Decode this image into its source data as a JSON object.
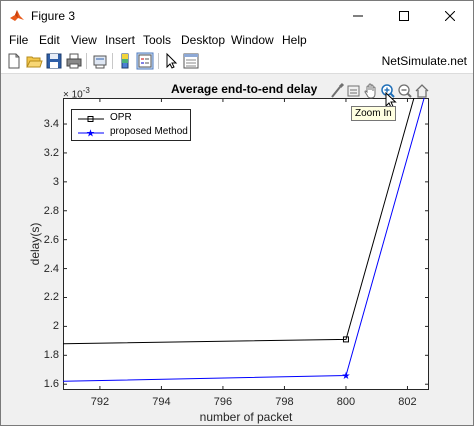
{
  "window": {
    "title": "Figure 3",
    "controls": {
      "minimize": "minimize",
      "maximize": "maximize",
      "close": "close"
    }
  },
  "menu": {
    "items": [
      "File",
      "Edit",
      "View",
      "Insert",
      "Tools",
      "Desktop",
      "Window",
      "Help"
    ]
  },
  "toolbar": {
    "buttons": [
      "new-figure-icon",
      "open-file-icon",
      "save-icon",
      "print-icon",
      "print-preview-icon",
      "link-icon",
      "insert-colorbar-icon",
      "insert-legend-icon",
      "edit-plot-icon",
      "property-inspector-icon"
    ],
    "brand": "NetSimulate.net"
  },
  "axes_toolbar": {
    "buttons": [
      "brush-icon",
      "data-tips-icon",
      "pan-icon",
      "zoom-in-icon",
      "zoom-out-icon",
      "home-icon"
    ],
    "tooltip": "Zoom In"
  },
  "chart_data": {
    "type": "line",
    "title": "Average end-to-end delay",
    "xlabel": "number of packet",
    "ylabel": "delay(s)",
    "y_exponent_base": "× 10",
    "y_exponent_power": "-3",
    "xlim": [
      790.8,
      802.7
    ],
    "ylim": [
      1.56,
      3.58
    ],
    "xticks": [
      "792",
      "794",
      "796",
      "798",
      "800",
      "802"
    ],
    "xtick_values": [
      792,
      794,
      796,
      798,
      800,
      802
    ],
    "yticks": [
      "1.6",
      "1.8",
      "2",
      "2.2",
      "2.4",
      "2.6",
      "2.8",
      "3",
      "3.2",
      "3.4"
    ],
    "ytick_values": [
      1.6,
      1.8,
      2.0,
      2.2,
      2.4,
      2.6,
      2.8,
      3.0,
      3.2,
      3.4
    ],
    "grid": false,
    "legend_position": "top-left",
    "series": [
      {
        "name": "OPR",
        "color": "#000000",
        "marker": "square",
        "x": [
          790.8,
          800,
          802.7
        ],
        "y": [
          1.88,
          1.91,
          3.95
        ]
      },
      {
        "name": "proposed Method",
        "color": "#0000ff",
        "marker": "star",
        "x": [
          790.8,
          800,
          802.7
        ],
        "y": [
          1.62,
          1.66,
          3.7
        ]
      }
    ]
  }
}
